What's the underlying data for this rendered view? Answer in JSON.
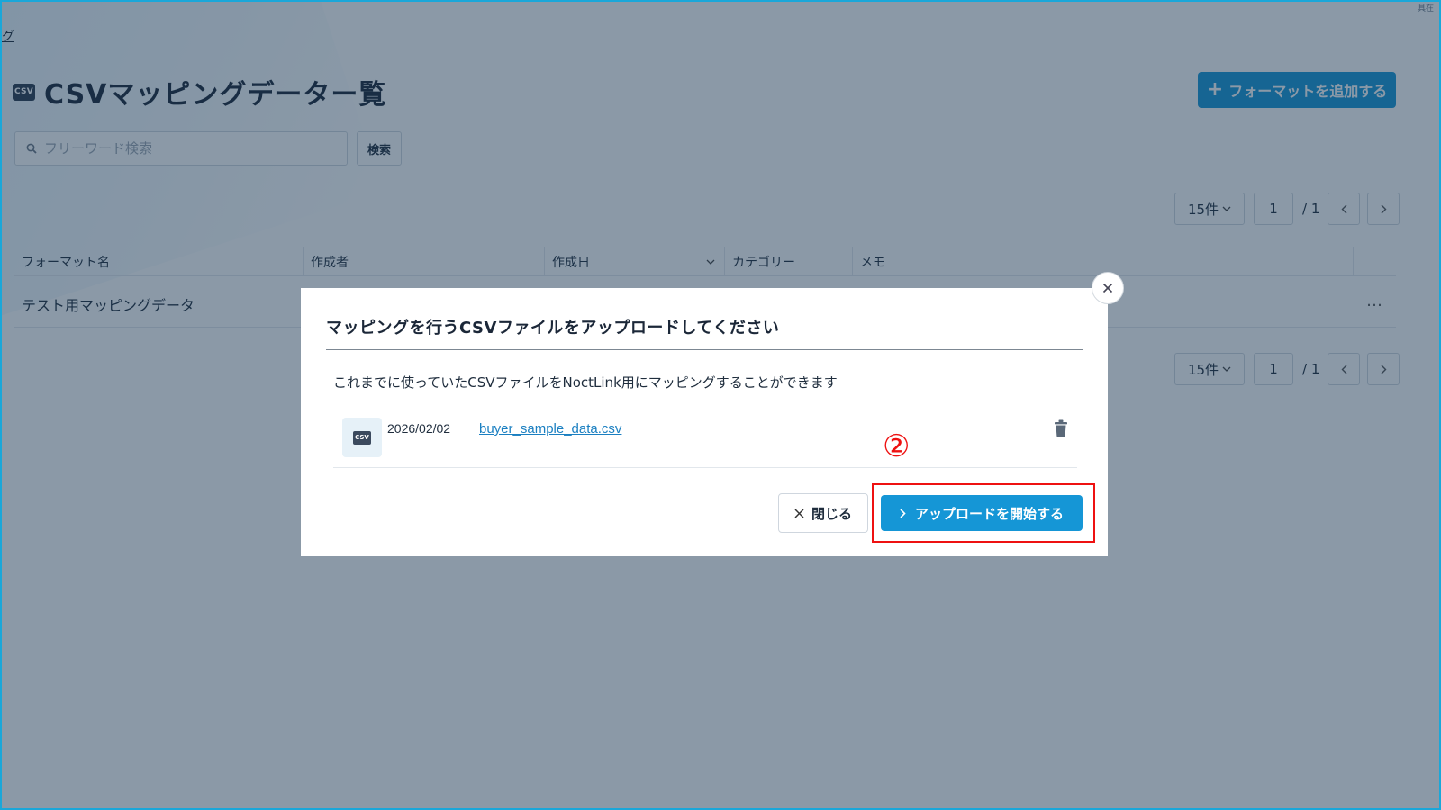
{
  "breadcrumb": "グ",
  "top_right_note": "具在",
  "page": {
    "title": "CSVマッピングデーター覧",
    "title_badge": "CSV",
    "add_format_label": "フォーマットを追加する"
  },
  "search": {
    "placeholder": "フリーワード検索",
    "button_label": "検索"
  },
  "pagination": {
    "per_page": "15件",
    "current_page": "1",
    "total_pages": "/ 1"
  },
  "table": {
    "columns": [
      "フォーマット名",
      "作成者",
      "作成日",
      "カテゴリー",
      "メモ"
    ],
    "rows": [
      {
        "format_name": "テスト用マッピングデータ"
      }
    ],
    "more": "…"
  },
  "modal": {
    "title": "マッピングを行うCSVファイルをアップロードしてください",
    "description": "これまでに使っていたCSVファイルをNoctLink用にマッピングすることができます",
    "file": {
      "icon_label": "CSV",
      "date": "2026/02/02",
      "name": "buyer_sample_data.csv"
    },
    "close_label": "閉じる",
    "upload_label": "アップロードを開始する"
  },
  "annotation": {
    "step_number": "②",
    "highlight_color": "#e11111"
  },
  "colors": {
    "accent": "#1596d6",
    "overlay": "rgba(23,52,79,0.50)"
  }
}
